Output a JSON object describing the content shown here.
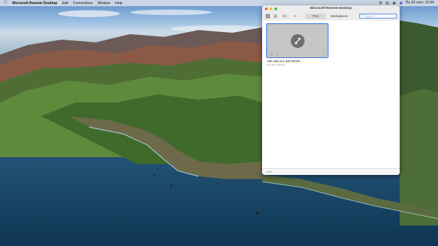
{
  "menubar": {
    "apple_icon": "apple-icon",
    "app_name": "Microsoft Remote Desktop",
    "menus": [
      "Edit",
      "Connections",
      "Window",
      "Help"
    ],
    "clock": "Пн 23 сент. 15:34"
  },
  "window": {
    "title": "Microsoft Remote Desktop",
    "tabs": [
      {
        "label": "PCs",
        "selected": true
      },
      {
        "label": "Workspaces",
        "selected": false
      }
    ],
    "search": {
      "placeholder": "Search",
      "value": ""
    },
    "pcs": [
      {
        "name": "185.196.214.100:30100",
        "user": "No user account"
      }
    ],
    "status": "1 PC"
  },
  "colors": {
    "accent": "#3478f6",
    "close": "#fe5f57",
    "minimize": "#febc2e",
    "maximize": "#28c840"
  }
}
